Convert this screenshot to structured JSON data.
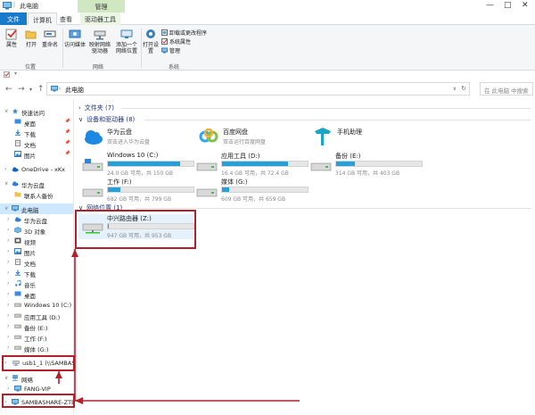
{
  "window": {
    "title": "此电脑",
    "context_tab": "管理"
  },
  "tabs": [
    {
      "label": "文件"
    },
    {
      "label": "计算机"
    },
    {
      "label": "查看"
    },
    {
      "label": "驱动器工具"
    }
  ],
  "ribbon": {
    "location_group": {
      "label": "位置",
      "buttons": [
        "属性",
        "打开",
        "重命名"
      ]
    },
    "network_group": {
      "label": "网络",
      "buttons": [
        "访问媒体",
        "映射网络驱动器",
        "添加一个网络位置"
      ]
    },
    "system_group": {
      "label": "系统",
      "open_settings": "打开设置",
      "items": [
        "卸载或更改程序",
        "系统属性",
        "管理"
      ]
    }
  },
  "address": {
    "path": "此电脑",
    "search_placeholder": "在 此电脑 中搜索"
  },
  "sidebar": {
    "items": [
      {
        "label": "快速访问",
        "icon": "star-icon",
        "level": 0
      },
      {
        "label": "桌面",
        "icon": "desktop-icon",
        "level": 1,
        "pinned": true
      },
      {
        "label": "下载",
        "icon": "download-icon",
        "level": 1,
        "pinned": true
      },
      {
        "label": "文档",
        "icon": "document-icon",
        "level": 1,
        "pinned": true
      },
      {
        "label": "图片",
        "icon": "picture-icon",
        "level": 1,
        "pinned": true
      },
      {
        "label": "OneDrive - xKx",
        "icon": "cloud-icon",
        "level": 0
      },
      {
        "label": "华为云盘",
        "icon": "cloud-icon",
        "level": 0
      },
      {
        "label": "联系人备份",
        "icon": "folder-icon",
        "level": 1
      },
      {
        "label": "此电脑",
        "icon": "computer-icon",
        "level": 0,
        "selected": true
      },
      {
        "label": "华为云盘",
        "icon": "cloud-icon",
        "level": 1
      },
      {
        "label": "3D 对象",
        "icon": "cube-icon",
        "level": 1
      },
      {
        "label": "视频",
        "icon": "video-icon",
        "level": 1
      },
      {
        "label": "图片",
        "icon": "picture-icon",
        "level": 1
      },
      {
        "label": "文档",
        "icon": "document-icon",
        "level": 1
      },
      {
        "label": "下载",
        "icon": "download-icon",
        "level": 1
      },
      {
        "label": "音乐",
        "icon": "music-icon",
        "level": 1
      },
      {
        "label": "桌面",
        "icon": "desktop-icon",
        "level": 1
      },
      {
        "label": "Windows 10 (C:)",
        "icon": "drive-icon",
        "level": 1
      },
      {
        "label": "应用工具 (D:)",
        "icon": "drive-icon",
        "level": 1
      },
      {
        "label": "备份 (E:)",
        "icon": "drive-icon",
        "level": 1
      },
      {
        "label": "工作 (F:)",
        "icon": "drive-icon",
        "level": 1
      },
      {
        "label": "媒体 (G:)",
        "icon": "drive-icon",
        "level": 1
      },
      {
        "label": "usb1_1 (\\\\SAMBAS",
        "icon": "network-drive-icon",
        "level": 1
      },
      {
        "label": "网络",
        "icon": "network-icon",
        "level": 0
      },
      {
        "label": "FANG-VIP",
        "icon": "computer-icon",
        "level": 1
      },
      {
        "label": "SAMBASHARE-ZTE",
        "icon": "computer-icon",
        "level": 1
      }
    ]
  },
  "main": {
    "folders_header": "文件夹 (7)",
    "devices_header": "设备和驱动器 (8)",
    "network_header": "网络位置 (1)",
    "cloud_items": [
      {
        "label": "华为云盘",
        "sub": "双击进入华为云盘"
      },
      {
        "label": "百度网盘",
        "sub": "双击运行百度网盘"
      },
      {
        "label": "手机助理",
        "sub": ""
      }
    ],
    "drives": [
      {
        "label": "Windows 10 (C:)",
        "sub": "24.0 GB 可用，共 150 GB",
        "used": 0.84
      },
      {
        "label": "应用工具 (D:)",
        "sub": "16.4 GB 可用，共 72.4 GB",
        "used": 0.77
      },
      {
        "label": "备份 (E:)",
        "sub": "314 GB 可用，共 403 GB",
        "used": 0.22
      },
      {
        "label": "工作 (F:)",
        "sub": "682 GB 可用，共 799 GB",
        "used": 0.15
      },
      {
        "label": "媒体 (G:)",
        "sub": "609 GB 可用，共 659 GB",
        "used": 0.08
      }
    ],
    "network_drive": {
      "label": "中兴路由器 (Z:)",
      "sub": "947 GB 可用，共 953 GB",
      "used": 0.01
    }
  },
  "colors": {
    "accent": "#1979ca",
    "annotation": "#b3202a",
    "bar_fill": "#26a0da"
  }
}
